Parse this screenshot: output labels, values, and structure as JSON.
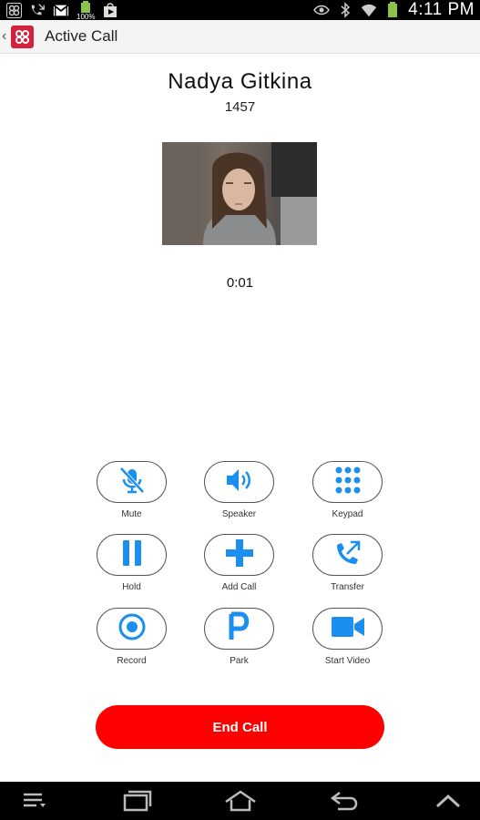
{
  "status_bar": {
    "time": "4:11 PM",
    "battery_label": "100%",
    "icons": [
      "app-notification-icon",
      "missed-call-icon",
      "gmail-icon",
      "battery-full-icon",
      "play-store-icon",
      "eye-icon",
      "bluetooth-icon",
      "wifi-icon",
      "battery-icon"
    ]
  },
  "app_bar": {
    "title": "Active Call"
  },
  "call": {
    "name": "Nadya Gitkina",
    "number": "1457",
    "duration": "0:01"
  },
  "controls": [
    {
      "id": "mute",
      "label": "Mute",
      "icon": "mic-off-icon"
    },
    {
      "id": "speaker",
      "label": "Speaker",
      "icon": "speaker-icon"
    },
    {
      "id": "keypad",
      "label": "Keypad",
      "icon": "keypad-icon"
    },
    {
      "id": "hold",
      "label": "Hold",
      "icon": "pause-icon"
    },
    {
      "id": "add-call",
      "label": "Add Call",
      "icon": "plus-icon"
    },
    {
      "id": "transfer",
      "label": "Transfer",
      "icon": "phone-transfer-icon"
    },
    {
      "id": "record",
      "label": "Record",
      "icon": "record-icon"
    },
    {
      "id": "park",
      "label": "Park",
      "icon": "park-icon"
    },
    {
      "id": "start-video",
      "label": "Start Video",
      "icon": "video-camera-icon"
    }
  ],
  "end_call_label": "End Call",
  "colors": {
    "accent_blue": "#1a8ff0",
    "end_call_red": "#ff0000",
    "brand_red": "#d4203a"
  },
  "nav_bar": {
    "icons": [
      "menu-icon",
      "recent-apps-icon",
      "home-icon",
      "back-icon",
      "chevron-up-icon"
    ]
  }
}
